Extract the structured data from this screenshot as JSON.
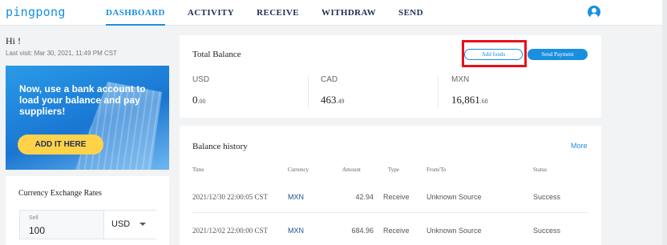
{
  "app": {
    "logo": "pingpong"
  },
  "nav": [
    {
      "label": "DASHBOARD",
      "active": true
    },
    {
      "label": "ACTIVITY"
    },
    {
      "label": "RECEIVE"
    },
    {
      "label": "WITHDRAW"
    },
    {
      "label": "SEND"
    }
  ],
  "greeting": {
    "hi": "Hi !",
    "last_visit": "Last visit: Mar 30, 2021, 11:49 PM CST"
  },
  "promo": {
    "text": "Now, use a bank account to load your balance and pay suppliers!",
    "button": "ADD IT HERE"
  },
  "exchange": {
    "title": "Currency Exchange Rates",
    "sell_label": "Sell",
    "sell_value": "100",
    "currency": "USD"
  },
  "total_balance": {
    "title": "Total Balance",
    "add_funds": "Add funds",
    "send_payment": "Send Payment",
    "currencies": [
      {
        "code": "USD",
        "whole": "0",
        "decimal": ".00"
      },
      {
        "code": "CAD",
        "whole": "463",
        "decimal": ".49"
      },
      {
        "code": "MXN",
        "whole": "16,861",
        "decimal": ".68"
      }
    ]
  },
  "history": {
    "title": "Balance history",
    "more": "More",
    "columns": [
      "Time",
      "Currency",
      "Amount",
      "Type",
      "From/To",
      "Status"
    ],
    "rows": [
      {
        "time": "2021/12/30 22:00:05 CST",
        "currency": "MXN",
        "amount": "42.94",
        "type": "Receive",
        "from_to": "Unknown Source",
        "status": "Success"
      },
      {
        "time": "2021/12/02 22:00:00 CST",
        "currency": "MXN",
        "amount": "684.96",
        "type": "Receive",
        "from_to": "Unknown Source",
        "status": "Success"
      }
    ]
  },
  "colors": {
    "accent": "#1a8fe0",
    "highlight": "#e8101a",
    "promo_button": "#ffd24a"
  }
}
